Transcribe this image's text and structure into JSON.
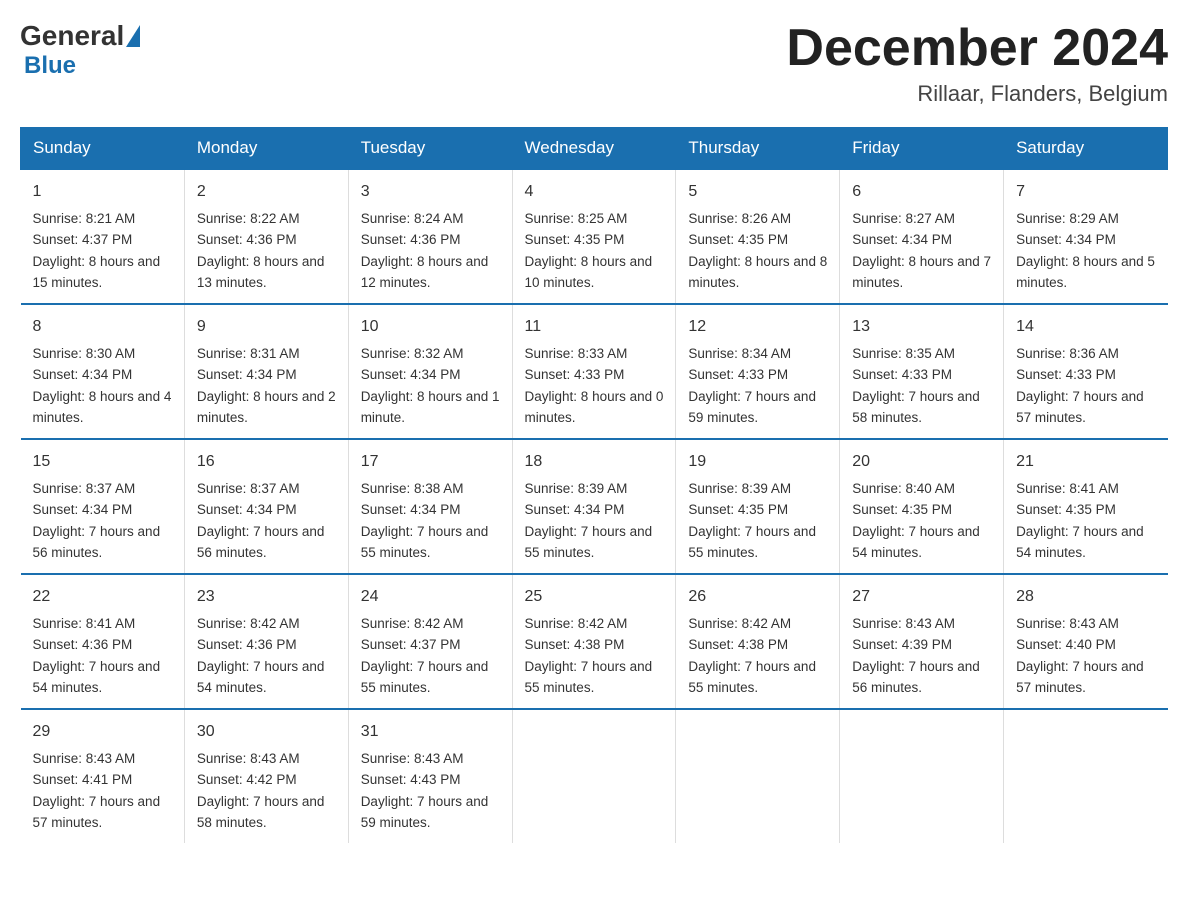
{
  "header": {
    "logo_general": "General",
    "logo_blue": "Blue",
    "month_title": "December 2024",
    "location": "Rillaar, Flanders, Belgium"
  },
  "days_of_week": [
    "Sunday",
    "Monday",
    "Tuesday",
    "Wednesday",
    "Thursday",
    "Friday",
    "Saturday"
  ],
  "weeks": [
    [
      {
        "day": "1",
        "sunrise": "8:21 AM",
        "sunset": "4:37 PM",
        "daylight": "8 hours and 15 minutes."
      },
      {
        "day": "2",
        "sunrise": "8:22 AM",
        "sunset": "4:36 PM",
        "daylight": "8 hours and 13 minutes."
      },
      {
        "day": "3",
        "sunrise": "8:24 AM",
        "sunset": "4:36 PM",
        "daylight": "8 hours and 12 minutes."
      },
      {
        "day": "4",
        "sunrise": "8:25 AM",
        "sunset": "4:35 PM",
        "daylight": "8 hours and 10 minutes."
      },
      {
        "day": "5",
        "sunrise": "8:26 AM",
        "sunset": "4:35 PM",
        "daylight": "8 hours and 8 minutes."
      },
      {
        "day": "6",
        "sunrise": "8:27 AM",
        "sunset": "4:34 PM",
        "daylight": "8 hours and 7 minutes."
      },
      {
        "day": "7",
        "sunrise": "8:29 AM",
        "sunset": "4:34 PM",
        "daylight": "8 hours and 5 minutes."
      }
    ],
    [
      {
        "day": "8",
        "sunrise": "8:30 AM",
        "sunset": "4:34 PM",
        "daylight": "8 hours and 4 minutes."
      },
      {
        "day": "9",
        "sunrise": "8:31 AM",
        "sunset": "4:34 PM",
        "daylight": "8 hours and 2 minutes."
      },
      {
        "day": "10",
        "sunrise": "8:32 AM",
        "sunset": "4:34 PM",
        "daylight": "8 hours and 1 minute."
      },
      {
        "day": "11",
        "sunrise": "8:33 AM",
        "sunset": "4:33 PM",
        "daylight": "8 hours and 0 minutes."
      },
      {
        "day": "12",
        "sunrise": "8:34 AM",
        "sunset": "4:33 PM",
        "daylight": "7 hours and 59 minutes."
      },
      {
        "day": "13",
        "sunrise": "8:35 AM",
        "sunset": "4:33 PM",
        "daylight": "7 hours and 58 minutes."
      },
      {
        "day": "14",
        "sunrise": "8:36 AM",
        "sunset": "4:33 PM",
        "daylight": "7 hours and 57 minutes."
      }
    ],
    [
      {
        "day": "15",
        "sunrise": "8:37 AM",
        "sunset": "4:34 PM",
        "daylight": "7 hours and 56 minutes."
      },
      {
        "day": "16",
        "sunrise": "8:37 AM",
        "sunset": "4:34 PM",
        "daylight": "7 hours and 56 minutes."
      },
      {
        "day": "17",
        "sunrise": "8:38 AM",
        "sunset": "4:34 PM",
        "daylight": "7 hours and 55 minutes."
      },
      {
        "day": "18",
        "sunrise": "8:39 AM",
        "sunset": "4:34 PM",
        "daylight": "7 hours and 55 minutes."
      },
      {
        "day": "19",
        "sunrise": "8:39 AM",
        "sunset": "4:35 PM",
        "daylight": "7 hours and 55 minutes."
      },
      {
        "day": "20",
        "sunrise": "8:40 AM",
        "sunset": "4:35 PM",
        "daylight": "7 hours and 54 minutes."
      },
      {
        "day": "21",
        "sunrise": "8:41 AM",
        "sunset": "4:35 PM",
        "daylight": "7 hours and 54 minutes."
      }
    ],
    [
      {
        "day": "22",
        "sunrise": "8:41 AM",
        "sunset": "4:36 PM",
        "daylight": "7 hours and 54 minutes."
      },
      {
        "day": "23",
        "sunrise": "8:42 AM",
        "sunset": "4:36 PM",
        "daylight": "7 hours and 54 minutes."
      },
      {
        "day": "24",
        "sunrise": "8:42 AM",
        "sunset": "4:37 PM",
        "daylight": "7 hours and 55 minutes."
      },
      {
        "day": "25",
        "sunrise": "8:42 AM",
        "sunset": "4:38 PM",
        "daylight": "7 hours and 55 minutes."
      },
      {
        "day": "26",
        "sunrise": "8:42 AM",
        "sunset": "4:38 PM",
        "daylight": "7 hours and 55 minutes."
      },
      {
        "day": "27",
        "sunrise": "8:43 AM",
        "sunset": "4:39 PM",
        "daylight": "7 hours and 56 minutes."
      },
      {
        "day": "28",
        "sunrise": "8:43 AM",
        "sunset": "4:40 PM",
        "daylight": "7 hours and 57 minutes."
      }
    ],
    [
      {
        "day": "29",
        "sunrise": "8:43 AM",
        "sunset": "4:41 PM",
        "daylight": "7 hours and 57 minutes."
      },
      {
        "day": "30",
        "sunrise": "8:43 AM",
        "sunset": "4:42 PM",
        "daylight": "7 hours and 58 minutes."
      },
      {
        "day": "31",
        "sunrise": "8:43 AM",
        "sunset": "4:43 PM",
        "daylight": "7 hours and 59 minutes."
      },
      null,
      null,
      null,
      null
    ]
  ]
}
